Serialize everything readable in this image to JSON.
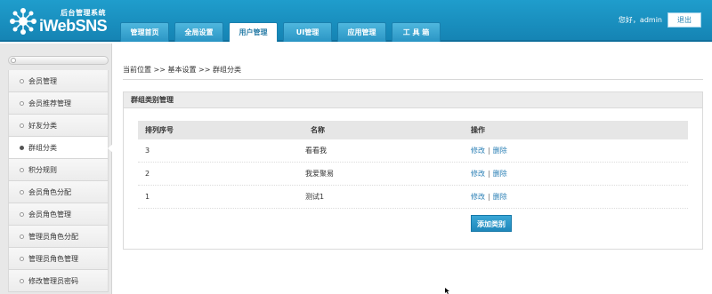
{
  "header": {
    "logo_subtitle": "后台管理系统",
    "logo_title": "iWebSNS",
    "nav_tabs": [
      {
        "label": "管理首页"
      },
      {
        "label": "全局设置"
      },
      {
        "label": "用户管理"
      },
      {
        "label": "UI管理"
      },
      {
        "label": "应用管理"
      },
      {
        "label": "工 具 箱"
      }
    ],
    "active_tab": "用户管理",
    "greeting": "您好，admin",
    "logout_label": "退出"
  },
  "sidebar": {
    "items": [
      {
        "label": "会员管理"
      },
      {
        "label": "会员推荐管理"
      },
      {
        "label": "好友分类"
      },
      {
        "label": "群组分类"
      },
      {
        "label": "积分规则"
      },
      {
        "label": "会员角色分配"
      },
      {
        "label": "会员角色管理"
      },
      {
        "label": "管理员角色分配"
      },
      {
        "label": "管理员角色管理"
      },
      {
        "label": "修改管理员密码"
      }
    ],
    "active_item": "群组分类"
  },
  "breadcrumb": "当前位置 >> 基本设置 >> 群组分类",
  "panel": {
    "title": "群组类别管理",
    "columns": {
      "order": "排列序号",
      "name": "名称",
      "actions": "操作"
    },
    "rows": [
      {
        "order": "3",
        "name": "看看我"
      },
      {
        "order": "2",
        "name": "我爱聚易"
      },
      {
        "order": "1",
        "name": "测试1"
      }
    ],
    "edit_label": "修改",
    "delete_label": "删除",
    "separator": "|",
    "add_button_label": "添加类别"
  },
  "colors": {
    "header_blue": "#1a92c2",
    "link_blue": "#2a7fb5",
    "button_blue": "#2a98c8"
  }
}
